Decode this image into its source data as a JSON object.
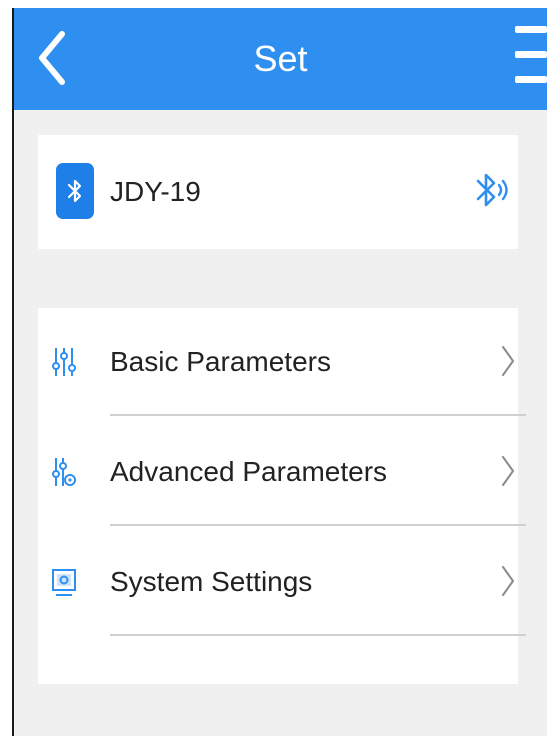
{
  "header": {
    "title": "Set",
    "back_icon": "chevron-left-icon",
    "menu_icon": "hamburger-menu-icon",
    "background_color": "#2f8ff0"
  },
  "device": {
    "name": "JDY-19",
    "badge_icon": "bluetooth-icon",
    "status_icon": "bluetooth-connected-icon",
    "accent_color": "#1e7fe8"
  },
  "settings": {
    "items": [
      {
        "label": "Basic Parameters",
        "icon": "sliders-icon"
      },
      {
        "label": "Advanced Parameters",
        "icon": "advanced-sliders-icon"
      },
      {
        "label": "System Settings",
        "icon": "monitor-settings-icon"
      }
    ]
  }
}
